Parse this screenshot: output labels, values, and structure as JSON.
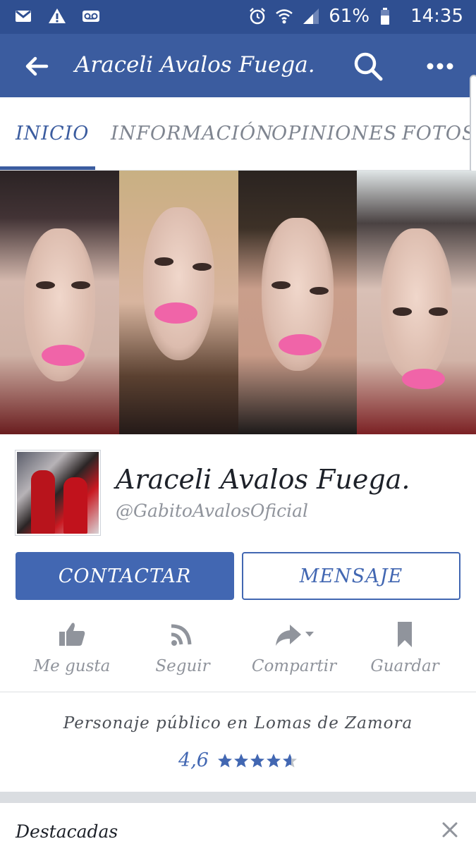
{
  "status_bar": {
    "battery_percent": "61%",
    "time": "14:35",
    "icons": [
      "gmail-icon",
      "warning-icon",
      "voicemail-icon",
      "alarm-icon",
      "wifi-icon",
      "signal-icon",
      "battery-icon"
    ]
  },
  "app_bar": {
    "title": "Araceli Avalos Fuega.",
    "icons": [
      "back-arrow-icon",
      "search-icon",
      "more-icon"
    ]
  },
  "tabs": [
    {
      "label": "INICIO",
      "active": true
    },
    {
      "label": "INFORMACIÓN",
      "active": false
    },
    {
      "label": "OPINIONES",
      "active": false
    },
    {
      "label": "FOTOS",
      "active": false
    }
  ],
  "profile": {
    "name": "Araceli Avalos Fuega.",
    "handle": "@GabitoAvalosOficial"
  },
  "buttons": {
    "contact": "CONTACTAR",
    "message": "MENSAJE"
  },
  "actions": [
    {
      "label": "Me gusta",
      "icon": "like-icon"
    },
    {
      "label": "Seguir",
      "icon": "follow-rss-icon"
    },
    {
      "label": "Compartir",
      "icon": "share-icon"
    },
    {
      "label": "Guardar",
      "icon": "bookmark-icon"
    }
  ],
  "about": {
    "category": "Personaje público en Lomas de Zamora",
    "rating": "4,6",
    "rating_stars_filled": 4.6
  },
  "featured": {
    "title": "Destacadas"
  },
  "colors": {
    "status_bar": "#2f4f91",
    "brand_blue": "#3b5c9f",
    "button_blue": "#4267b2",
    "muted_text": "#90949c"
  }
}
